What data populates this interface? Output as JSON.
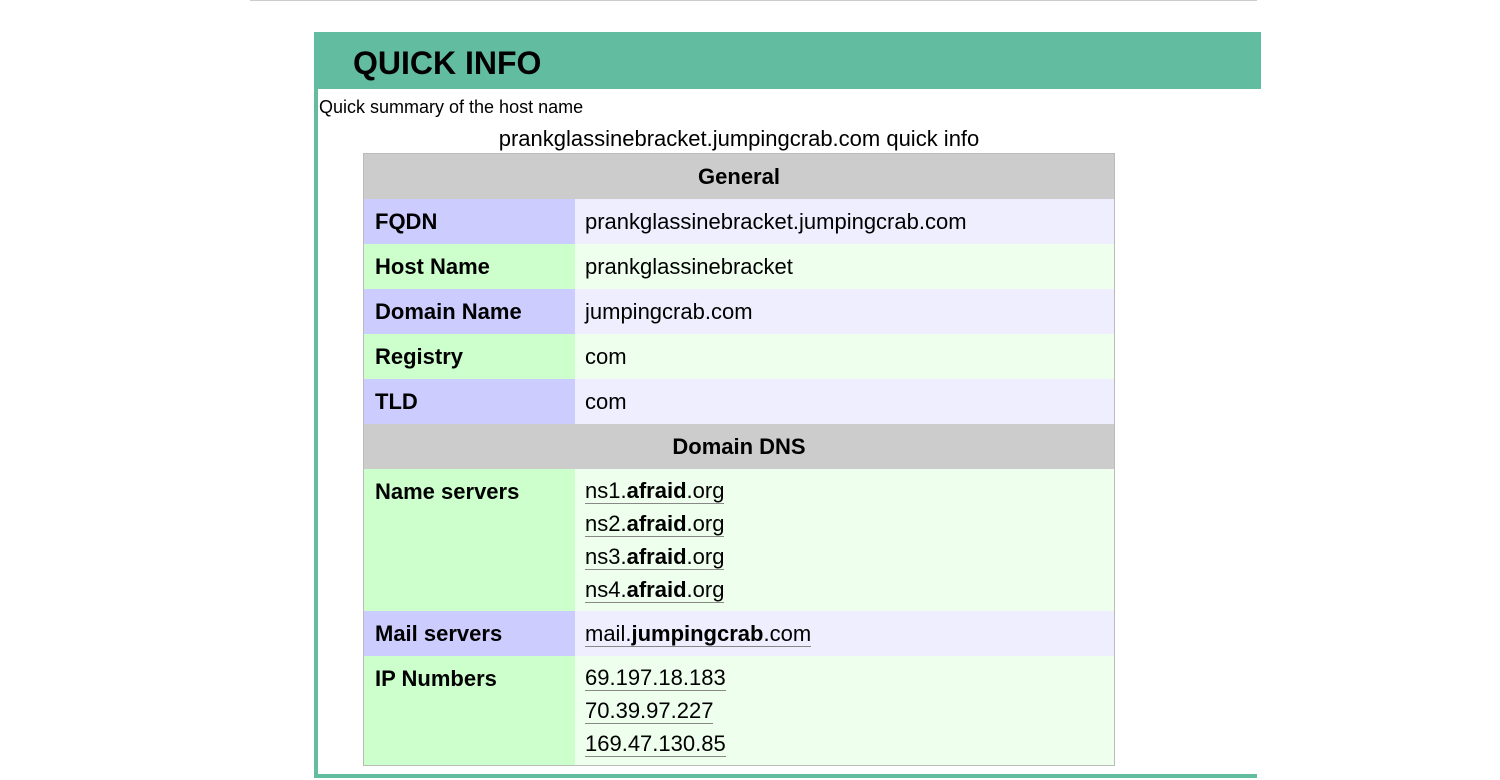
{
  "panel": {
    "title": "QUICK INFO",
    "summary": "Quick summary of the host name",
    "caption": "prankglassinebracket.jumpingcrab.com quick info"
  },
  "general": {
    "heading": "General",
    "rows": [
      {
        "label": "FQDN",
        "value": "prankglassinebracket.jumpingcrab.com"
      },
      {
        "label": "Host Name",
        "value": "prankglassinebracket"
      },
      {
        "label": "Domain Name",
        "value": "jumpingcrab.com"
      },
      {
        "label": "Registry",
        "value": "com"
      },
      {
        "label": "TLD",
        "value": "com"
      }
    ]
  },
  "dns": {
    "heading": "Domain DNS",
    "name_servers_label": "Name servers",
    "name_servers": [
      {
        "pre": "ns1.",
        "bold": "afraid",
        "post": ".org"
      },
      {
        "pre": "ns2.",
        "bold": "afraid",
        "post": ".org"
      },
      {
        "pre": "ns3.",
        "bold": "afraid",
        "post": ".org"
      },
      {
        "pre": "ns4.",
        "bold": "afraid",
        "post": ".org"
      }
    ],
    "mail_servers_label": "Mail servers",
    "mail_server": {
      "pre": "mail.",
      "bold": "jumpingcrab",
      "post": ".com"
    },
    "ip_label": "IP Numbers",
    "ips": [
      "69.197.18.183",
      "70.39.97.227",
      "169.47.130.85"
    ]
  },
  "colors": {
    "accent": "#62bc9f",
    "section_bg": "#cccccc",
    "key_blue": "#ccccff",
    "val_blue": "#eeeeff",
    "key_green": "#ccffcc",
    "val_green": "#eeffee"
  }
}
